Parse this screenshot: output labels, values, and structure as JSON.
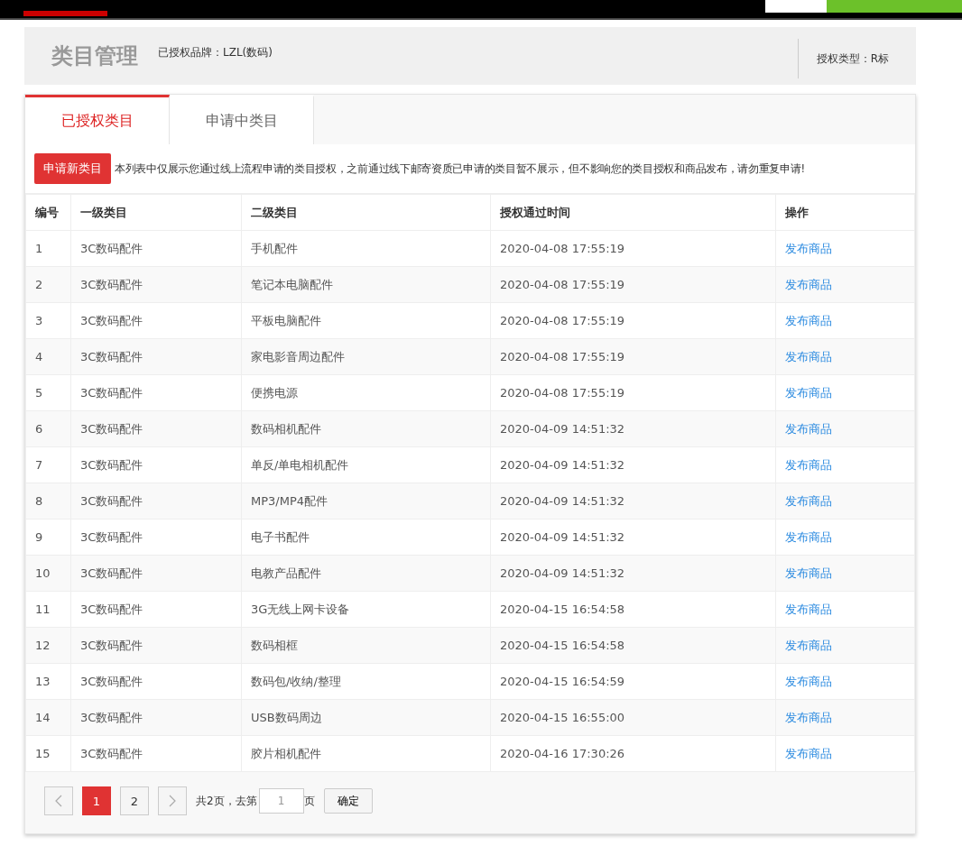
{
  "header": {
    "title": "类目管理",
    "brand": "已授权品牌：LZL(数码)",
    "auth_type": "授权类型：R标"
  },
  "tabs": [
    {
      "label": "已授权类目",
      "selected": true
    },
    {
      "label": "申请中类目",
      "selected": false
    }
  ],
  "notice": {
    "button": "申请新类目",
    "text": "本列表中仅展示您通过线上流程申请的类目授权，之前通过线下邮寄资质已申请的类目暂不展示，但不影响您的类目授权和商品发布，请勿重复申请!"
  },
  "table": {
    "columns": [
      "编号",
      "一级类目",
      "二级类目",
      "授权通过时间",
      "操作"
    ],
    "rows": [
      {
        "no": "1",
        "level1": "3C数码配件",
        "level2": "手机配件",
        "time": "2020-04-08 17:55:19",
        "action": "发布商品"
      },
      {
        "no": "2",
        "level1": "3C数码配件",
        "level2": "笔记本电脑配件",
        "time": "2020-04-08 17:55:19",
        "action": "发布商品"
      },
      {
        "no": "3",
        "level1": "3C数码配件",
        "level2": "平板电脑配件",
        "time": "2020-04-08 17:55:19",
        "action": "发布商品"
      },
      {
        "no": "4",
        "level1": "3C数码配件",
        "level2": "家电影音周边配件",
        "time": "2020-04-08 17:55:19",
        "action": "发布商品"
      },
      {
        "no": "5",
        "level1": "3C数码配件",
        "level2": "便携电源",
        "time": "2020-04-08 17:55:19",
        "action": "发布商品"
      },
      {
        "no": "6",
        "level1": "3C数码配件",
        "level2": "数码相机配件",
        "time": "2020-04-09 14:51:32",
        "action": "发布商品"
      },
      {
        "no": "7",
        "level1": "3C数码配件",
        "level2": "单反/单电相机配件",
        "time": "2020-04-09 14:51:32",
        "action": "发布商品"
      },
      {
        "no": "8",
        "level1": "3C数码配件",
        "level2": "MP3/MP4配件",
        "time": "2020-04-09 14:51:32",
        "action": "发布商品"
      },
      {
        "no": "9",
        "level1": "3C数码配件",
        "level2": "电子书配件",
        "time": "2020-04-09 14:51:32",
        "action": "发布商品"
      },
      {
        "no": "10",
        "level1": "3C数码配件",
        "level2": "电教产品配件",
        "time": "2020-04-09 14:51:32",
        "action": "发布商品"
      },
      {
        "no": "11",
        "level1": "3C数码配件",
        "level2": "3G无线上网卡设备",
        "time": "2020-04-15 16:54:58",
        "action": "发布商品"
      },
      {
        "no": "12",
        "level1": "3C数码配件",
        "level2": "数码相框",
        "time": "2020-04-15 16:54:58",
        "action": "发布商品"
      },
      {
        "no": "13",
        "level1": "3C数码配件",
        "level2": "数码包/收纳/整理",
        "time": "2020-04-15 16:54:59",
        "action": "发布商品"
      },
      {
        "no": "14",
        "level1": "3C数码配件",
        "level2": "USB数码周边",
        "time": "2020-04-15 16:55:00",
        "action": "发布商品"
      },
      {
        "no": "15",
        "level1": "3C数码配件",
        "level2": "胶片相机配件",
        "time": "2020-04-16 17:30:26",
        "action": "发布商品"
      }
    ]
  },
  "pagination": {
    "pages": [
      {
        "label": "1",
        "selected": true
      },
      {
        "label": "2",
        "selected": false
      }
    ],
    "summary": "共2页，去第",
    "goto_value": "1",
    "suffix": "页",
    "confirm": "确定"
  }
}
